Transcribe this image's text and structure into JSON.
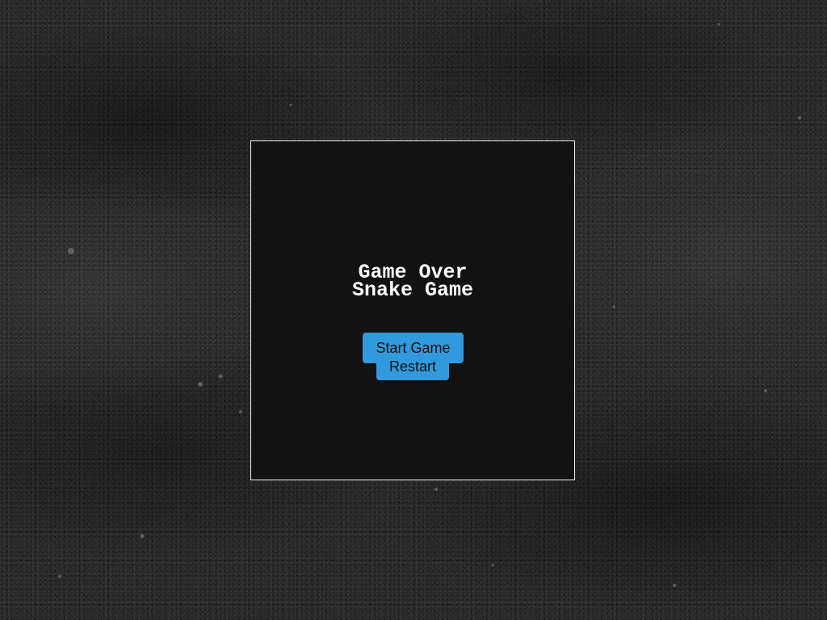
{
  "game": {
    "game_over_text": "Game Over",
    "title": "Snake Game",
    "start_button": "Start Game",
    "restart_button": "Restart"
  },
  "colors": {
    "board_background": "#121212",
    "board_border": "#f0f0f0",
    "button": "#3399dd",
    "text": "#ffffff"
  }
}
